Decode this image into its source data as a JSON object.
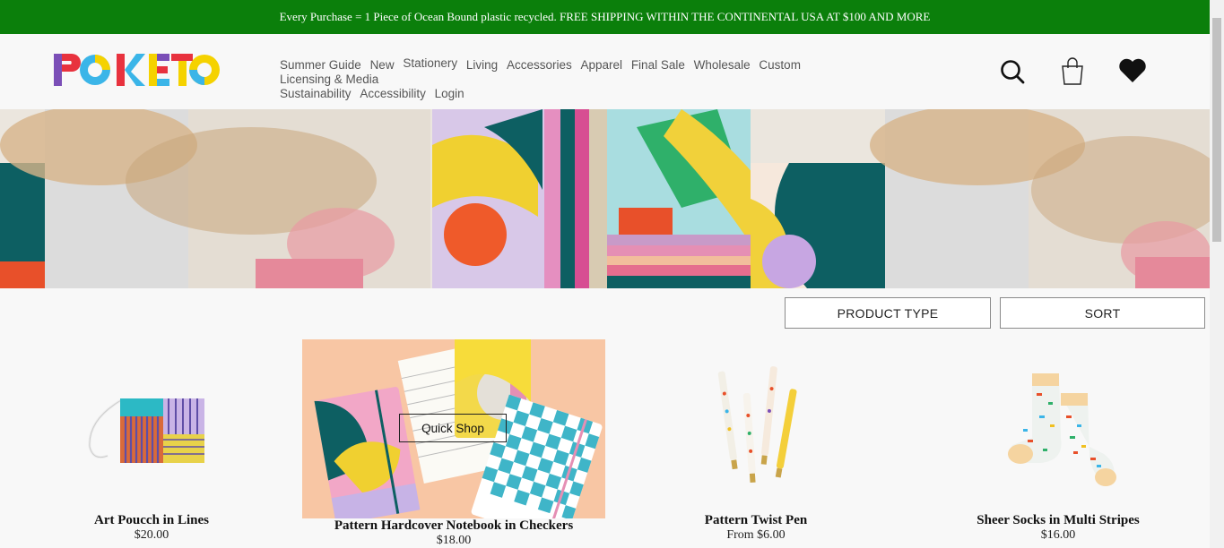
{
  "banner": {
    "text": "Every Purchase = 1 Piece of Ocean Bound plastic recycled. FREE SHIPPING WITHIN THE CONTINENTAL USA AT $100 AND MORE"
  },
  "header": {
    "logo_text": "POKETO",
    "nav": [
      "Summer Guide",
      "New",
      "Stationery",
      "Living",
      "Accessories",
      "Apparel",
      "Final Sale",
      "Wholesale",
      "Custom",
      "Licensing & Media",
      "Sustainability",
      "Accessibility",
      "Login"
    ],
    "icons": [
      "search-icon",
      "bag-icon",
      "heart-icon"
    ]
  },
  "filters": {
    "product_type": "PRODUCT TYPE",
    "sort": "SORT"
  },
  "products": [
    {
      "title": "Art Poucch in Lines",
      "price": "$20.00"
    },
    {
      "title": "Pattern Hardcover Notebook in Checkers",
      "price": "$18.00",
      "quick_shop": "Quick Shop"
    },
    {
      "title": "Pattern Twist Pen",
      "price": "From $6.00"
    },
    {
      "title": "Sheer Socks in Multi Stripes",
      "price": "$16.00"
    }
  ],
  "colors": {
    "banner_green": "#0b7f0b",
    "logo_red": "#e8323e",
    "logo_yellow": "#f5d200",
    "logo_blue": "#3bb5e8",
    "logo_purple": "#7b4fb7"
  }
}
